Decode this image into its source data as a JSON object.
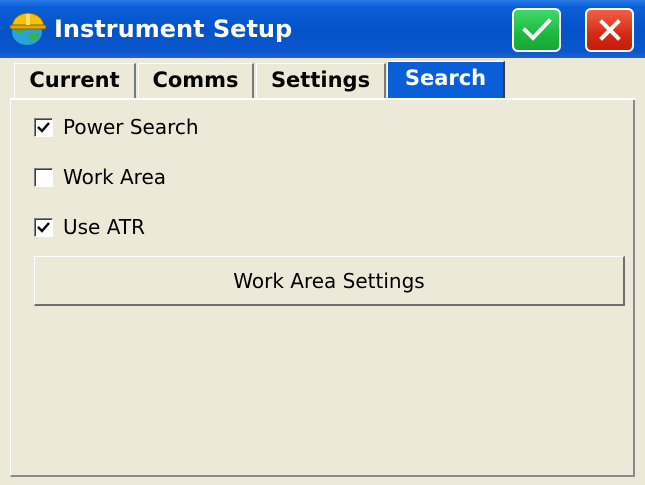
{
  "window": {
    "title": "Instrument Setup",
    "icon": "hardhat-globe-icon",
    "ok_icon": "checkmark-icon",
    "close_icon": "close-icon"
  },
  "tabs": [
    {
      "label": "Current",
      "active": false
    },
    {
      "label": "Comms",
      "active": false
    },
    {
      "label": "Settings",
      "active": false
    },
    {
      "label": "Search",
      "active": true
    }
  ],
  "options": [
    {
      "label": "Power Search",
      "checked": true
    },
    {
      "label": "Work Area",
      "checked": false
    },
    {
      "label": "Use ATR",
      "checked": true
    }
  ],
  "buttons": {
    "work_area_settings": "Work Area Settings"
  },
  "colors": {
    "titlebar": "#0553c9",
    "active_tab": "#0a5fd8",
    "ok_button": "#1fb83e",
    "close_button": "#d52a14",
    "background": "#ece9d8"
  }
}
